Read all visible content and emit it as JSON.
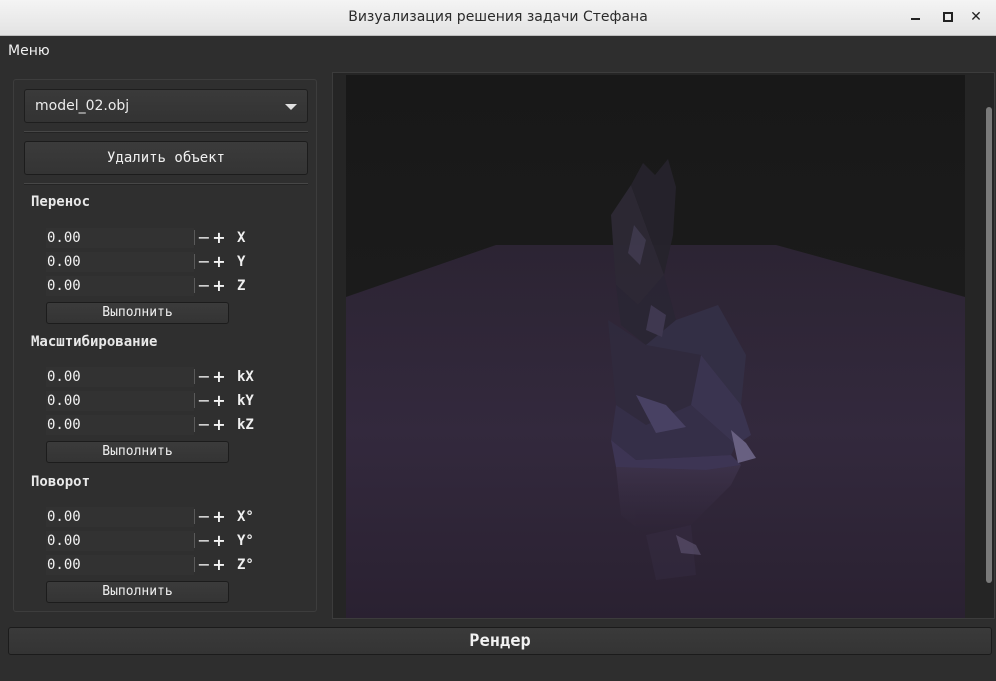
{
  "window": {
    "title": "Визуализация решения задачи Стефана"
  },
  "menu": {
    "label": "Меню"
  },
  "panel": {
    "model_select": {
      "value": "model_02.obj"
    },
    "delete_button": "Удалить объект",
    "execute_label": "Выполнить",
    "translate": {
      "title": "Перенос",
      "rows": [
        {
          "value": "0.00",
          "axis": "X"
        },
        {
          "value": "0.00",
          "axis": "Y"
        },
        {
          "value": "0.00",
          "axis": "Z"
        }
      ]
    },
    "scale": {
      "title": "Масштибирование",
      "rows": [
        {
          "value": "0.00",
          "axis": "kX"
        },
        {
          "value": "0.00",
          "axis": "kY"
        },
        {
          "value": "0.00",
          "axis": "kZ"
        }
      ]
    },
    "rotate": {
      "title": "Поворот",
      "rows": [
        {
          "value": "0.00",
          "axis": "X°"
        },
        {
          "value": "0.00",
          "axis": "Y°"
        },
        {
          "value": "0.00",
          "axis": "Z°"
        }
      ]
    },
    "stepper": {
      "minus": "−",
      "plus": "+"
    }
  },
  "render_button": "Рендер",
  "colors": {
    "background": "#2e2e2e",
    "scene_wall": "#1d1d1d",
    "scene_floor": "#2f2536",
    "object_tint": "#3c3550"
  }
}
